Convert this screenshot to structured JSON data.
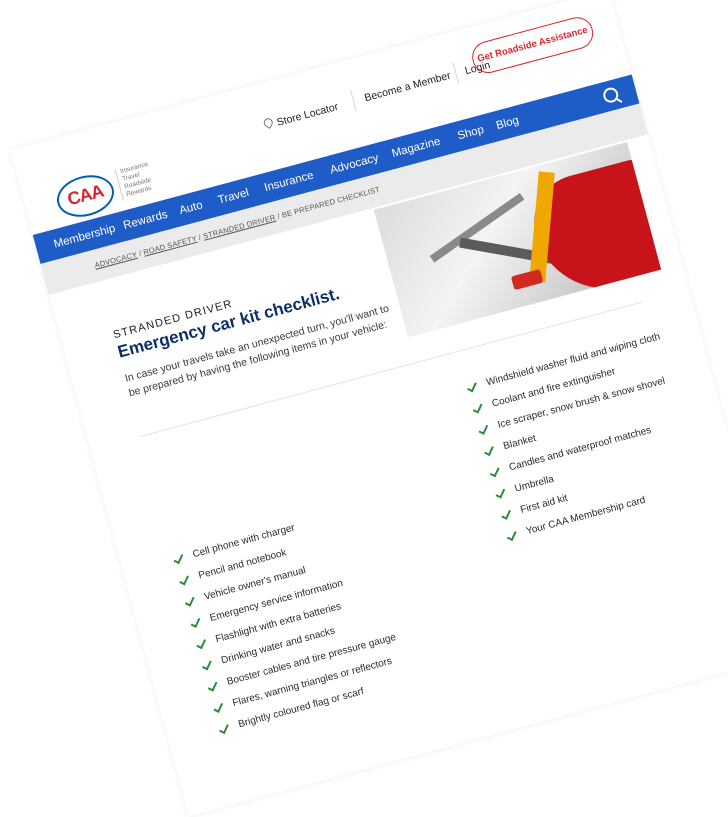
{
  "utility": {
    "store_locator": "Store Locator",
    "become_member": "Become a Member",
    "login": "Login",
    "roadside": "Get Roadside Assistance"
  },
  "logo": {
    "text": "CAA",
    "tags": [
      "Insurance",
      "Travel",
      "Roadside",
      "Rewards"
    ]
  },
  "nav": {
    "items": [
      "Membership",
      "Rewards",
      "Auto",
      "Travel",
      "Insurance",
      "Advocacy",
      "Magazine",
      "Shop",
      "Blog"
    ]
  },
  "breadcrumb": {
    "crumbs": [
      "ADVOCACY",
      "ROAD SAFETY",
      "STRANDED DRIVER"
    ],
    "current": "BE PREPARED CHECKLIST",
    "separator": " / "
  },
  "article": {
    "kicker": "STRANDED DRIVER",
    "title": "Emergency car kit checklist.",
    "intro": "In case your travels take an unexpected turn, you'll want to be prepared by having the following items in your vehicle:"
  },
  "checklist": {
    "left": [
      "Cell phone with charger",
      "Pencil and notebook",
      "Vehicle owner's manual",
      "Emergency service information",
      "Flashlight with extra batteries",
      "Drinking water and snacks",
      "Booster cables and tire pressure gauge",
      "Flares, warning triangles or reflectors",
      "Brightly coloured flag or scarf"
    ],
    "right": [
      "Windshield washer fluid and wiping cloth",
      "Coolant and fire extinguisher",
      "Ice scraper, snow brush & snow shovel",
      "Blanket",
      "Candles and waterproof matches",
      "Umbrella",
      "First aid kit",
      "Your CAA Membership card"
    ]
  },
  "colors": {
    "nav_blue": "#1e5cc7",
    "brand_red": "#d8262e",
    "title_navy": "#0b2e6b",
    "check_green": "#2e8b3a"
  }
}
